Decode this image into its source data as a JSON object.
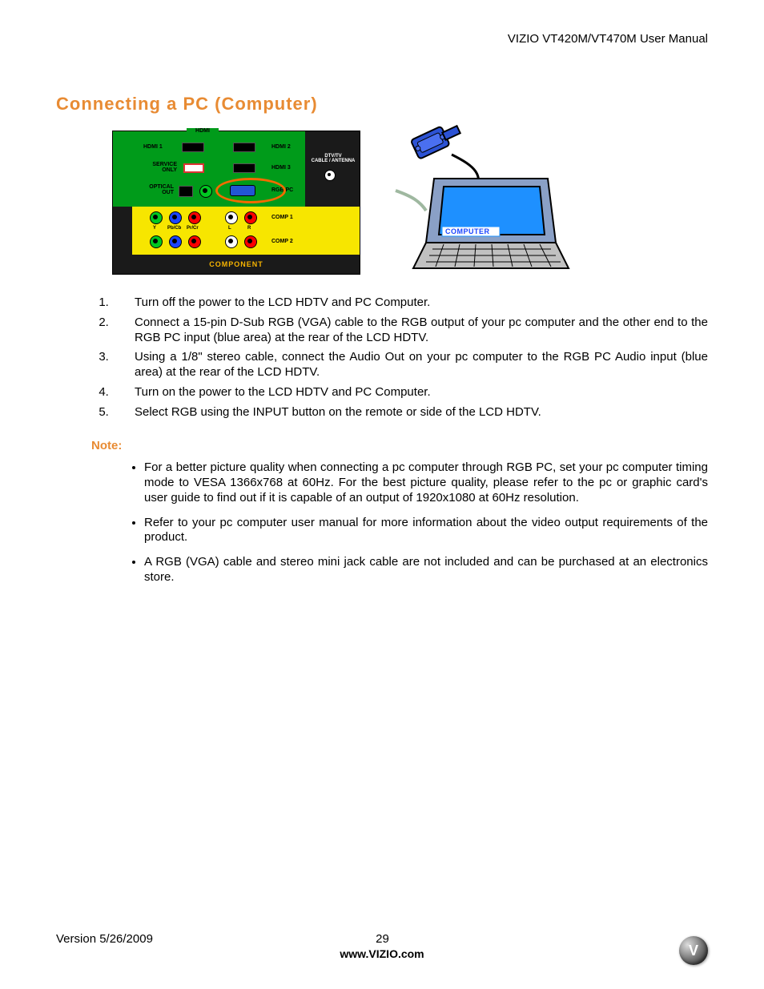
{
  "header": {
    "right_text": "VIZIO VT420M/VT470M User Manual"
  },
  "title": "Connecting a PC (Computer)",
  "panel": {
    "hdmi_tab": "HDMI",
    "hdmi1": "HDMI 1",
    "hdmi2": "HDMI 2",
    "hdmi3": "HDMI 3",
    "service": "SERVICE\nONLY",
    "optical": "OPTICAL\nOUT",
    "rgbpc": "RGB PC",
    "dtv": "DTV/TV\nCABLE / ANTENNA",
    "comp1": "COMP 1",
    "comp2": "COMP 2",
    "y": "Y",
    "pbcb": "Pb/Cb",
    "prcr": "Pr/Cr",
    "l": "L",
    "r": "R",
    "bottom_label": "COMPONENT"
  },
  "laptop": {
    "screen_label": "COMPUTER"
  },
  "steps": [
    "Turn off the power to the LCD HDTV and PC Computer.",
    "Connect a 15-pin D-Sub RGB (VGA) cable to the RGB output of your pc computer and the other end to the RGB PC input (blue area) at the rear of the LCD HDTV.",
    "Using a 1/8\" stereo cable, connect the Audio Out on your pc computer to the RGB PC Audio input (blue area) at the rear of the LCD HDTV.",
    "Turn on the power to the LCD HDTV and PC Computer.",
    "Select RGB using the INPUT button on the remote or side of the LCD HDTV."
  ],
  "note_label": "Note:",
  "notes": [
    "For a better picture quality when connecting a pc computer through RGB PC, set your pc computer timing mode to VESA 1366x768 at 60Hz.  For the best picture quality, please refer to the pc or graphic card's user guide to find out if it is capable of an output of 1920x1080 at 60Hz resolution.",
    "Refer to your pc computer user manual for more information about the video output requirements of the product.",
    "A RGB (VGA) cable and stereo mini jack cable are not included and can be purchased at an electronics store."
  ],
  "footer": {
    "version": "Version 5/26/2009",
    "page": "29",
    "url": "www.VIZIO.com",
    "logo_letter": "V"
  }
}
